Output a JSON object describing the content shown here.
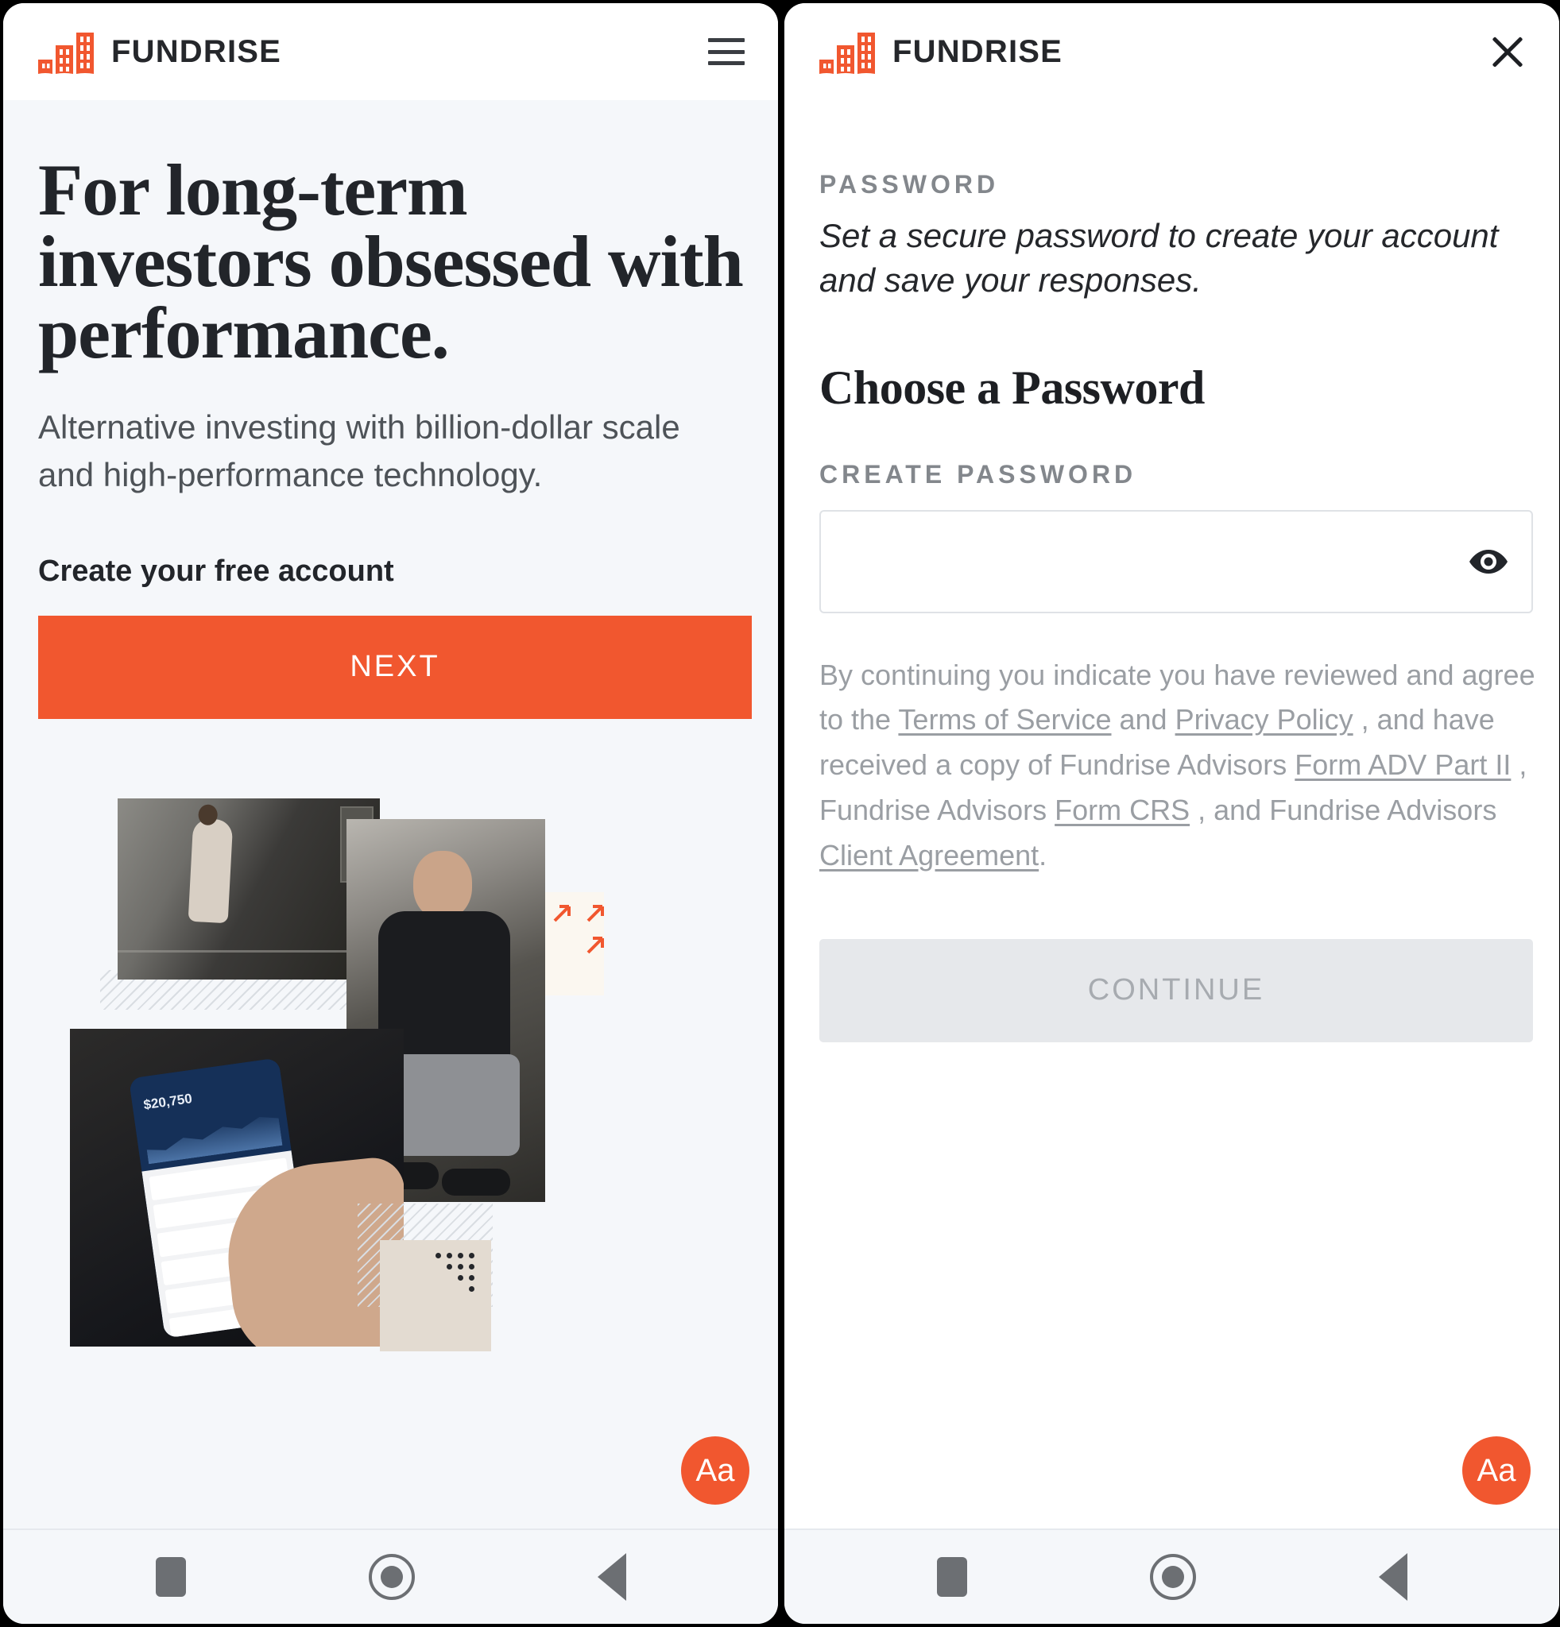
{
  "brand": {
    "name": "FUNDRISE",
    "logo_icon": "fundrise-buildings-logo",
    "accent_color": "#f1572f"
  },
  "left_screen": {
    "header": {
      "menu_icon": "hamburger-menu-icon"
    },
    "hero": {
      "headline": "For long-term investors obsessed with performance.",
      "subhead": "Alternative investing with billion-dollar scale and high-performance technology.",
      "cta_label": "Create your free account",
      "next_button": "NEXT"
    },
    "collage": {
      "phone_screen_amount": "$20,750",
      "alt_street": "woman-walking-photo",
      "alt_man": "man-sitting-photo",
      "alt_phone": "hand-holding-phone-photo",
      "arrows_icon": "expand-arrows-icon"
    },
    "font_size_button": "Aa"
  },
  "right_screen": {
    "header": {
      "close_icon": "close-x-icon"
    },
    "kicker": "PASSWORD",
    "kicker_desc": "Set a secure password to create your account and save your responses.",
    "section_title": "Choose a Password",
    "field_label": "CREATE PASSWORD",
    "password_value": "",
    "password_placeholder": "",
    "eye_icon": "eye-visibility-icon",
    "legal": {
      "part1": "By continuing you indicate you have reviewed and agree to the ",
      "link1": "Terms of Service",
      "part2": " and ",
      "link2": "Privacy Policy",
      "part3": " , and have received a copy of Fundrise Advisors ",
      "link3": "Form ADV Part II",
      "part4": " , Fundrise Advisors ",
      "link4": "Form CRS",
      "part5": " , and Fundrise Advisors ",
      "link5": "Client Agreement",
      "part6": "."
    },
    "continue_button": "CONTINUE",
    "font_size_button": "Aa"
  },
  "android_nav": {
    "recents_icon": "square-recents-icon",
    "home_icon": "circle-home-icon",
    "back_icon": "triangle-back-icon"
  }
}
